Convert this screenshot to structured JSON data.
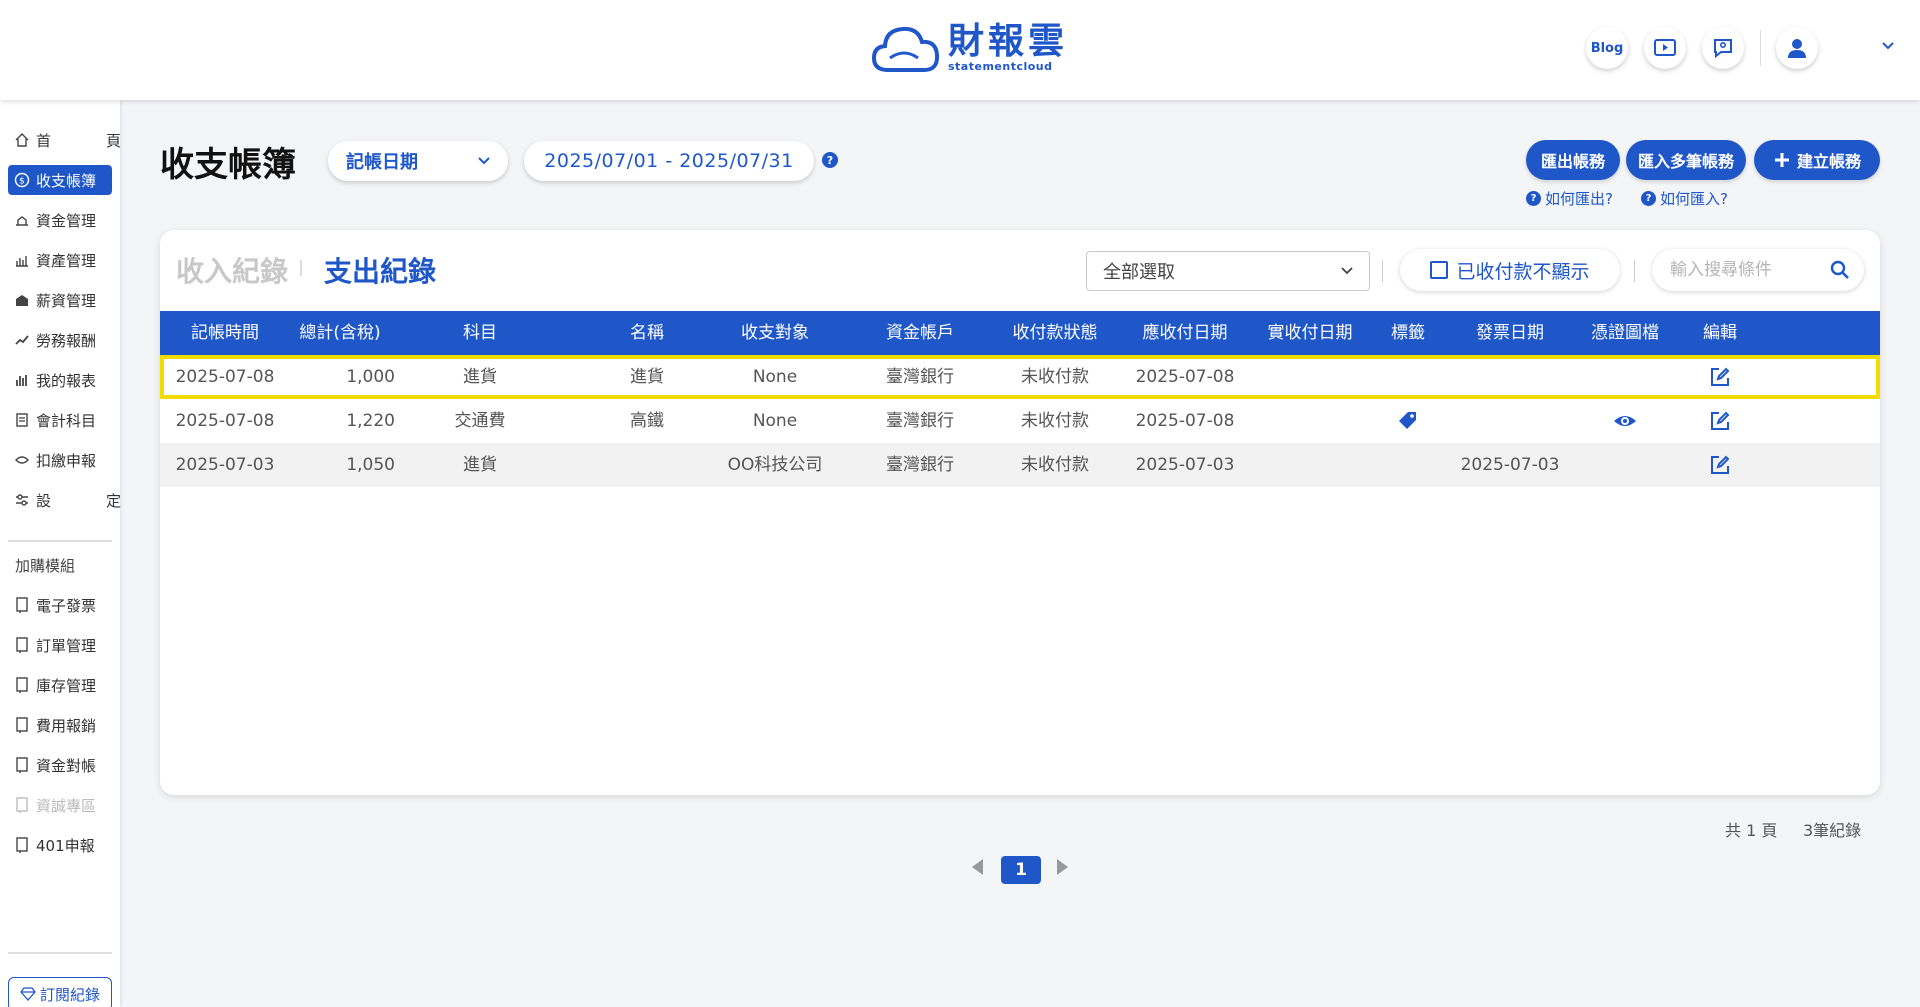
{
  "header": {
    "logo_name": "財報雲",
    "logo_sub": "statementcloud",
    "blog_label": "Blog"
  },
  "sidebar": {
    "items": [
      {
        "label": "首　頁",
        "icon": "home-icon"
      },
      {
        "label": "收支帳簿",
        "icon": "money-icon"
      },
      {
        "label": "資金管理",
        "icon": "fund-icon"
      },
      {
        "label": "資產管理",
        "icon": "asset-icon"
      },
      {
        "label": "薪資管理",
        "icon": "salary-icon"
      },
      {
        "label": "勞務報酬",
        "icon": "labor-icon"
      },
      {
        "label": "我的報表",
        "icon": "report-icon"
      },
      {
        "label": "會計科目",
        "icon": "ledger-icon"
      },
      {
        "label": "扣繳申報",
        "icon": "tax-icon"
      },
      {
        "label": "設　定",
        "icon": "settings-icon"
      }
    ],
    "section_label": "加購模組",
    "modules": [
      {
        "label": "電子發票"
      },
      {
        "label": "訂單管理"
      },
      {
        "label": "庫存管理"
      },
      {
        "label": "費用報銷"
      },
      {
        "label": "資金對帳"
      },
      {
        "label": "資誠專區"
      },
      {
        "label": "401申報"
      }
    ],
    "subscription_label": "訂閱紀錄"
  },
  "page": {
    "title": "收支帳簿",
    "date_field": "記帳日期",
    "date_range": "2025/07/01 - 2025/07/31",
    "help_mark": "?",
    "export_btn": "匯出帳務",
    "import_btn": "匯入多筆帳務",
    "create_btn": "建立帳務",
    "how_export": "如何匯出?",
    "how_import": "如何匯入?"
  },
  "records": {
    "tab_income": "收入紀錄",
    "tab_expense": "支出紀錄",
    "filter_value": "全部選取",
    "hide_paid_label": "已收付款不顯示",
    "search_placeholder": "輸入搜尋條件",
    "columns": [
      "記帳時間",
      "總計(含稅)",
      "科目",
      "名稱",
      "收支對象",
      "資金帳戶",
      "收付款狀態",
      "應收付日期",
      "實收付日期",
      "標籤",
      "發票日期",
      "憑證圖檔",
      "編輯"
    ],
    "rows": [
      {
        "date": "2025-07-08",
        "total": "1,000",
        "subject": "進貨",
        "name": "進貨",
        "party": "None",
        "account": "臺灣銀行",
        "status": "未收付款",
        "due": "2025-07-08",
        "paid": "",
        "tag": false,
        "invoice": "",
        "voucher": false
      },
      {
        "date": "2025-07-08",
        "total": "1,220",
        "subject": "交通費",
        "name": "高鐵",
        "party": "None",
        "account": "臺灣銀行",
        "status": "未收付款",
        "due": "2025-07-08",
        "paid": "",
        "tag": true,
        "invoice": "",
        "voucher": true
      },
      {
        "date": "2025-07-03",
        "total": "1,050",
        "subject": "進貨",
        "name": "",
        "party": "OO科技公司",
        "account": "臺灣銀行",
        "status": "未收付款",
        "due": "2025-07-03",
        "paid": "",
        "tag": false,
        "invoice": "2025-07-03",
        "voucher": false
      }
    ],
    "summary_pages": "共 1 頁",
    "summary_count": "3筆紀錄",
    "current_page": "1"
  },
  "colors": {
    "accent": "#1f57c9",
    "highlight": "#f2dc00"
  }
}
